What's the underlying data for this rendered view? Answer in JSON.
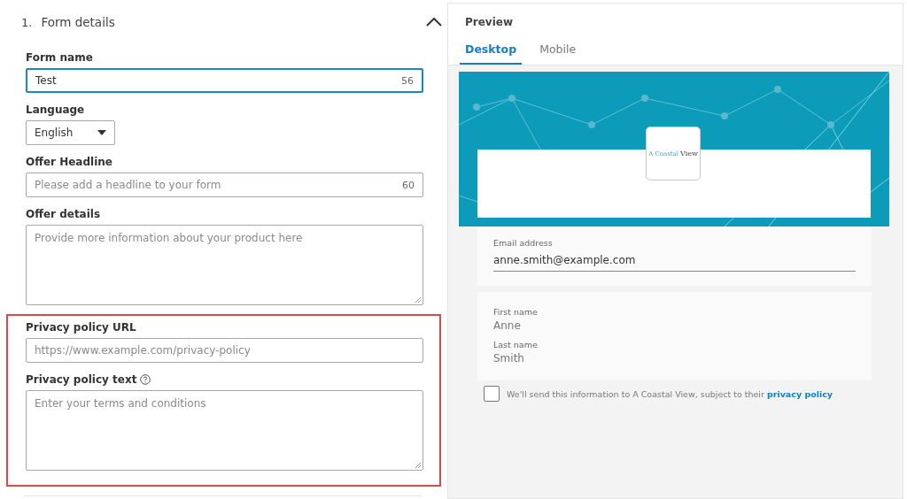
{
  "section": {
    "number": "1.",
    "title": "Form details",
    "expanded": true
  },
  "fields": [
    {
      "kind": "text",
      "label": "Form name",
      "value": "Test",
      "counter": "56",
      "focused": true
    },
    {
      "kind": "select",
      "label": "Language",
      "value": "English"
    },
    {
      "kind": "text",
      "label": "Offer Headline",
      "placeholder": "Please add a headline to your form",
      "counter": "60",
      "focused": false
    },
    {
      "kind": "textarea",
      "label": "Offer details",
      "placeholder": "Provide more information about your product here"
    }
  ],
  "highlight": {
    "fields": [
      {
        "kind": "text",
        "label": "Privacy policy URL",
        "placeholder": "https://www.example.com/privacy-policy",
        "focused": false
      },
      {
        "kind": "textarea",
        "label": "Privacy policy text",
        "placeholder": "Enter your terms and conditions",
        "help": true
      }
    ]
  },
  "preview": {
    "title": "Preview",
    "tabs": [
      {
        "label": "Desktop",
        "selected": true
      },
      {
        "label": "Mobile",
        "selected": false
      }
    ],
    "logo": {
      "text_1": "A Coastal",
      "text_2": "View"
    },
    "email": {
      "label": "Email address",
      "value": "anne.smith@example.com"
    },
    "names": [
      {
        "label": "First name",
        "value": "Anne"
      },
      {
        "label": "Last name",
        "value": "Smith"
      }
    ],
    "consent": {
      "checked": false,
      "text": "We'll send this information to A Coastal View, subject to their ",
      "link": "privacy policy"
    }
  }
}
